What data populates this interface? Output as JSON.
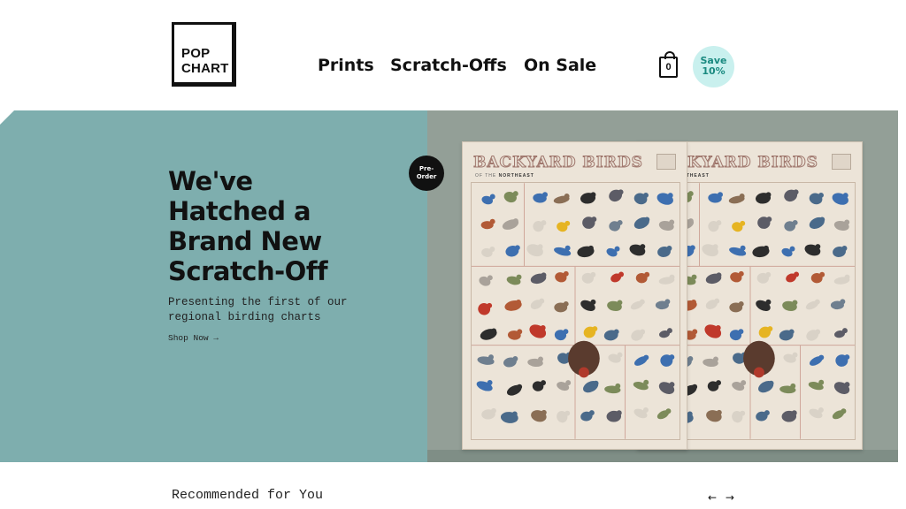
{
  "logo": {
    "line1": "POP",
    "line2": "CHART"
  },
  "nav": {
    "prints": "Prints",
    "scratch_offs": "Scratch-Offs",
    "on_sale": "On Sale"
  },
  "cart": {
    "count": "0"
  },
  "save_badge": {
    "line1": "Save",
    "line2": "10%"
  },
  "hero": {
    "headline": [
      "We've",
      "Hatched a",
      "Brand New",
      "Scratch-Off"
    ],
    "subline": "Presenting the first of our regional birding charts",
    "cta": "Shop Now →",
    "badge": {
      "line1": "Pre-",
      "line2": "Order"
    },
    "poster": {
      "title": "BACKYARD BIRDS",
      "subtitle_prefix": "OF THE",
      "subtitle_region": "NORTHEAST"
    }
  },
  "recommended": {
    "title": "Recommended for You",
    "prev": "←",
    "next": "→"
  },
  "colors": {
    "hero_teal": "#7eaeae",
    "hero_gray": "#939f97",
    "badge_mint": "#c9f0ee"
  }
}
